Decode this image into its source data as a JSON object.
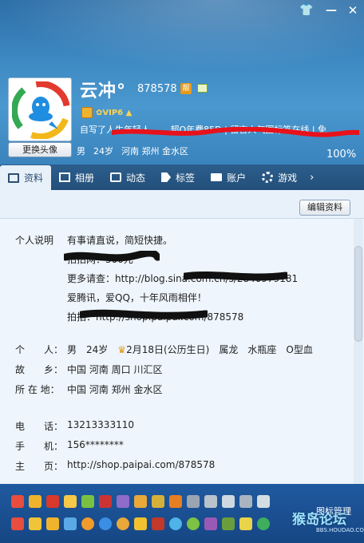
{
  "window": {
    "skin_icon": "tshirt-icon",
    "minimize_label": "—",
    "close_label": "✕"
  },
  "profile": {
    "nickname": "云冲°",
    "qq_number": "878578",
    "level_badge": "靓",
    "vip_badge": "VIP6",
    "signature": "自写了人生年轻人…… 超Q年费85D | 留言人气图标签在线 | 免",
    "change_avatar_label": "更换头像",
    "gender": "男",
    "age": "24岁",
    "location": "河南 郑州 金水区",
    "completeness": "100%"
  },
  "tabs": [
    {
      "label": "资料",
      "icon": "profile-card-icon",
      "active": true
    },
    {
      "label": "相册",
      "icon": "album-icon",
      "active": false
    },
    {
      "label": "动态",
      "icon": "feed-icon",
      "active": false
    },
    {
      "label": "标签",
      "icon": "tag-icon",
      "active": false
    },
    {
      "label": "账户",
      "icon": "wallet-icon",
      "active": false
    },
    {
      "label": "游戏",
      "icon": "game-icon",
      "active": false
    }
  ],
  "more_tabs_arrow": "›",
  "edit_button_label": "编辑资料",
  "details": {
    "personal_note_label": "个人说明",
    "personal_note_lines": [
      "有事请直说，简短快捷。",
      "拍拍网：300元",
      "更多请查：http://blog.sina.com.cn/s/2840979181",
      "爱腾讯，爱QQ，十年风雨相伴！",
      "拍拍：http://shop.paipai.com/878578"
    ],
    "person_label": "个　　人：",
    "person_gender": "男",
    "person_age": "24岁",
    "person_birthday": "2月18日(公历生日)",
    "person_zodiac_animal": "属龙",
    "person_constellation": "水瓶座",
    "person_blood": "O型血",
    "hometown_label": "故　　乡：",
    "hometown_value": "中国 河南 周口 川汇区",
    "residence_label": "所 在 地：",
    "residence_value": "中国 河南 郑州 金水区",
    "phone_label": "电　　话：",
    "phone_value": "13213333110",
    "mobile_label": "手　　机：",
    "mobile_value": "156********",
    "homepage_label": "主　　页：",
    "homepage_value": "http://shop.paipai.com/878578"
  },
  "badge_manage_label": "图标管理",
  "watermark": "猴岛论坛",
  "watermark_sub": "BBS.HOUDAO.COM",
  "colors": {
    "header_blue": "#3d88c2",
    "tab_bar": "#2c5e8d",
    "panel_bg": "#eef5fc",
    "badge_strip": "#1f5aa0"
  }
}
